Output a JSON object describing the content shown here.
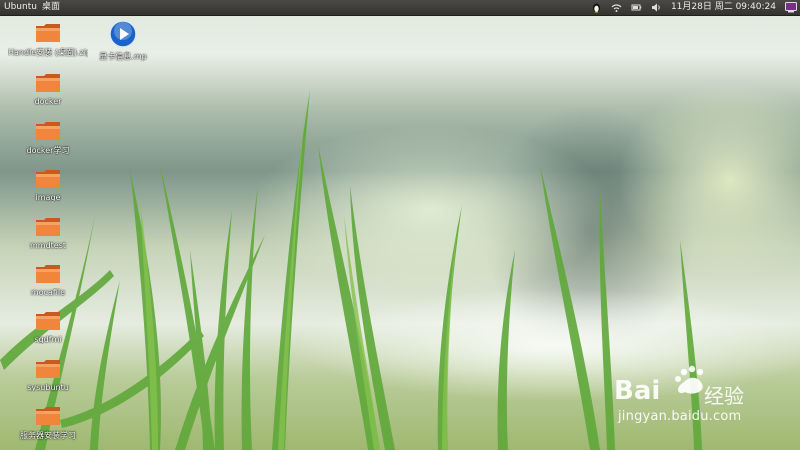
{
  "top_panel": {
    "app_name": "Ubuntu",
    "location": "桌面",
    "clock": "11月28日 周二 09:40:24"
  },
  "desktop": {
    "icons": [
      {
        "label": "Handle安装 (桌面).zip",
        "icon": "folder-icon"
      },
      {
        "label": "docker",
        "icon": "folder-icon"
      },
      {
        "label": "docker学习",
        "icon": "folder-icon"
      },
      {
        "label": "image",
        "icon": "folder-icon"
      },
      {
        "label": "mmdtest",
        "icon": "folder-icon"
      },
      {
        "label": "mocafile",
        "icon": "folder-icon"
      },
      {
        "label": "sgdfmi",
        "icon": "folder-icon"
      },
      {
        "label": "sysubuntu",
        "icon": "folder-icon"
      },
      {
        "label": "服务器安装学习",
        "icon": "folder-icon"
      },
      {
        "label": "显卡信息.mp",
        "icon": "media-play-icon"
      }
    ]
  },
  "watermark": {
    "brand": "Bai",
    "brand_suffix": "经验",
    "url": "jingyan.baidu.com"
  },
  "colors": {
    "panel_bg": "#3d3c38",
    "folder_orange": "#e8702a",
    "media_blue": "#1a63c8"
  }
}
